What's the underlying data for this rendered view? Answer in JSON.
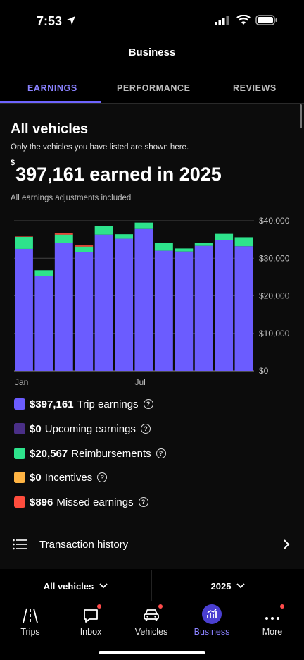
{
  "status_bar": {
    "time": "7:53"
  },
  "header": {
    "title": "Business"
  },
  "tabs": [
    {
      "label": "EARNINGS",
      "active": true
    },
    {
      "label": "PERFORMANCE",
      "active": false
    },
    {
      "label": "REVIEWS",
      "active": false
    }
  ],
  "summary": {
    "heading": "All vehicles",
    "subheading": "Only the vehicles you have listed are shown here.",
    "currency_symbol": "$",
    "earned_text": "397,161 earned in 2025",
    "adjustments_note": "All earnings adjustments included"
  },
  "chart_data": {
    "type": "bar",
    "stacked": true,
    "categories": [
      "Jan",
      "Feb",
      "Mar",
      "Apr",
      "May",
      "Jun",
      "Jul",
      "Aug",
      "Sep",
      "Oct",
      "Nov",
      "Dec"
    ],
    "x_tick_labels": [
      "Jan",
      "Jul"
    ],
    "y_tick_labels": [
      "$40,000",
      "$30,000",
      "$20,000",
      "$10,000",
      "$0"
    ],
    "ylim": [
      0,
      40000
    ],
    "grid": true,
    "series": [
      {
        "color": "#6b5cff",
        "values": [
          32500,
          25300,
          34100,
          31600,
          36300,
          35200,
          37800,
          32000,
          31800,
          33300,
          34800,
          33200
        ]
      },
      {
        "color": "#2ee38c",
        "values": [
          3200,
          1500,
          2200,
          1500,
          2300,
          1200,
          1700,
          2000,
          800,
          700,
          1700,
          2400
        ]
      },
      {
        "color": "#ff4d3d",
        "values": [
          100,
          0,
          300,
          300,
          0,
          0,
          0,
          0,
          0,
          100,
          0,
          0
        ]
      }
    ]
  },
  "legend": [
    {
      "value": "$397,161",
      "label": "Trip earnings",
      "color": "#6b5cff"
    },
    {
      "value": "$0",
      "label": "Upcoming earnings",
      "color": "#4a2f87"
    },
    {
      "value": "$20,567",
      "label": "Reimbursements",
      "color": "#2ee38c"
    },
    {
      "value": "$0",
      "label": "Incentives",
      "color": "#ffb443"
    },
    {
      "value": "$896",
      "label": "Missed earnings",
      "color": "#ff4d3d"
    }
  ],
  "transaction_history": {
    "label": "Transaction history"
  },
  "filters": {
    "vehicles": "All vehicles",
    "year": "2025"
  },
  "nav": [
    {
      "label": "Trips",
      "icon": "road-icon",
      "badge": false,
      "active": false
    },
    {
      "label": "Inbox",
      "icon": "chat-icon",
      "badge": true,
      "active": false
    },
    {
      "label": "Vehicles",
      "icon": "car-icon",
      "badge": true,
      "active": false
    },
    {
      "label": "Business",
      "icon": "chart-icon",
      "badge": false,
      "active": true
    },
    {
      "label": "More",
      "icon": "more-icon",
      "badge": true,
      "active": false
    }
  ]
}
